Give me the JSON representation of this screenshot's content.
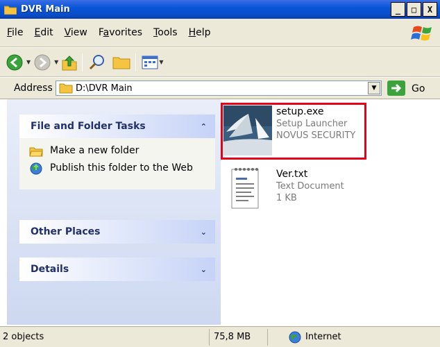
{
  "window": {
    "title": "DVR Main"
  },
  "window_buttons": [
    "_",
    "□",
    "X"
  ],
  "menu": [
    {
      "label": "File",
      "u": "F",
      "rest": "ile"
    },
    {
      "label": "Edit",
      "u": "E",
      "rest": "dit"
    },
    {
      "label": "View",
      "u": "V",
      "rest": "iew"
    },
    {
      "label": "Favorites",
      "pre": "F",
      "u": "a",
      "rest": "vorites"
    },
    {
      "label": "Tools",
      "u": "T",
      "rest": "ools"
    },
    {
      "label": "Help",
      "u": "H",
      "rest": "elp"
    }
  ],
  "address": {
    "label": "Address",
    "value": "D:\\DVR Main",
    "go": "Go"
  },
  "tasks": {
    "file_folder": {
      "header": "File and Folder Tasks",
      "links": [
        "Make a new folder",
        "Publish this folder to the Web"
      ]
    },
    "other_places": {
      "header": "Other Places"
    },
    "details": {
      "header": "Details"
    }
  },
  "files": [
    {
      "name": "setup.exe",
      "line2": "Setup Launcher",
      "line3": "NOVUS SECURITY"
    },
    {
      "name": "Ver.txt",
      "line2": "Text Document",
      "line3": "1 KB"
    }
  ],
  "status": {
    "objects": "2 objects",
    "size": "75,8 MB",
    "zone": "Internet"
  },
  "colors": {
    "titlebar": "#0a56d9",
    "highlight": "#e3001b",
    "go": "#3ca33c"
  }
}
